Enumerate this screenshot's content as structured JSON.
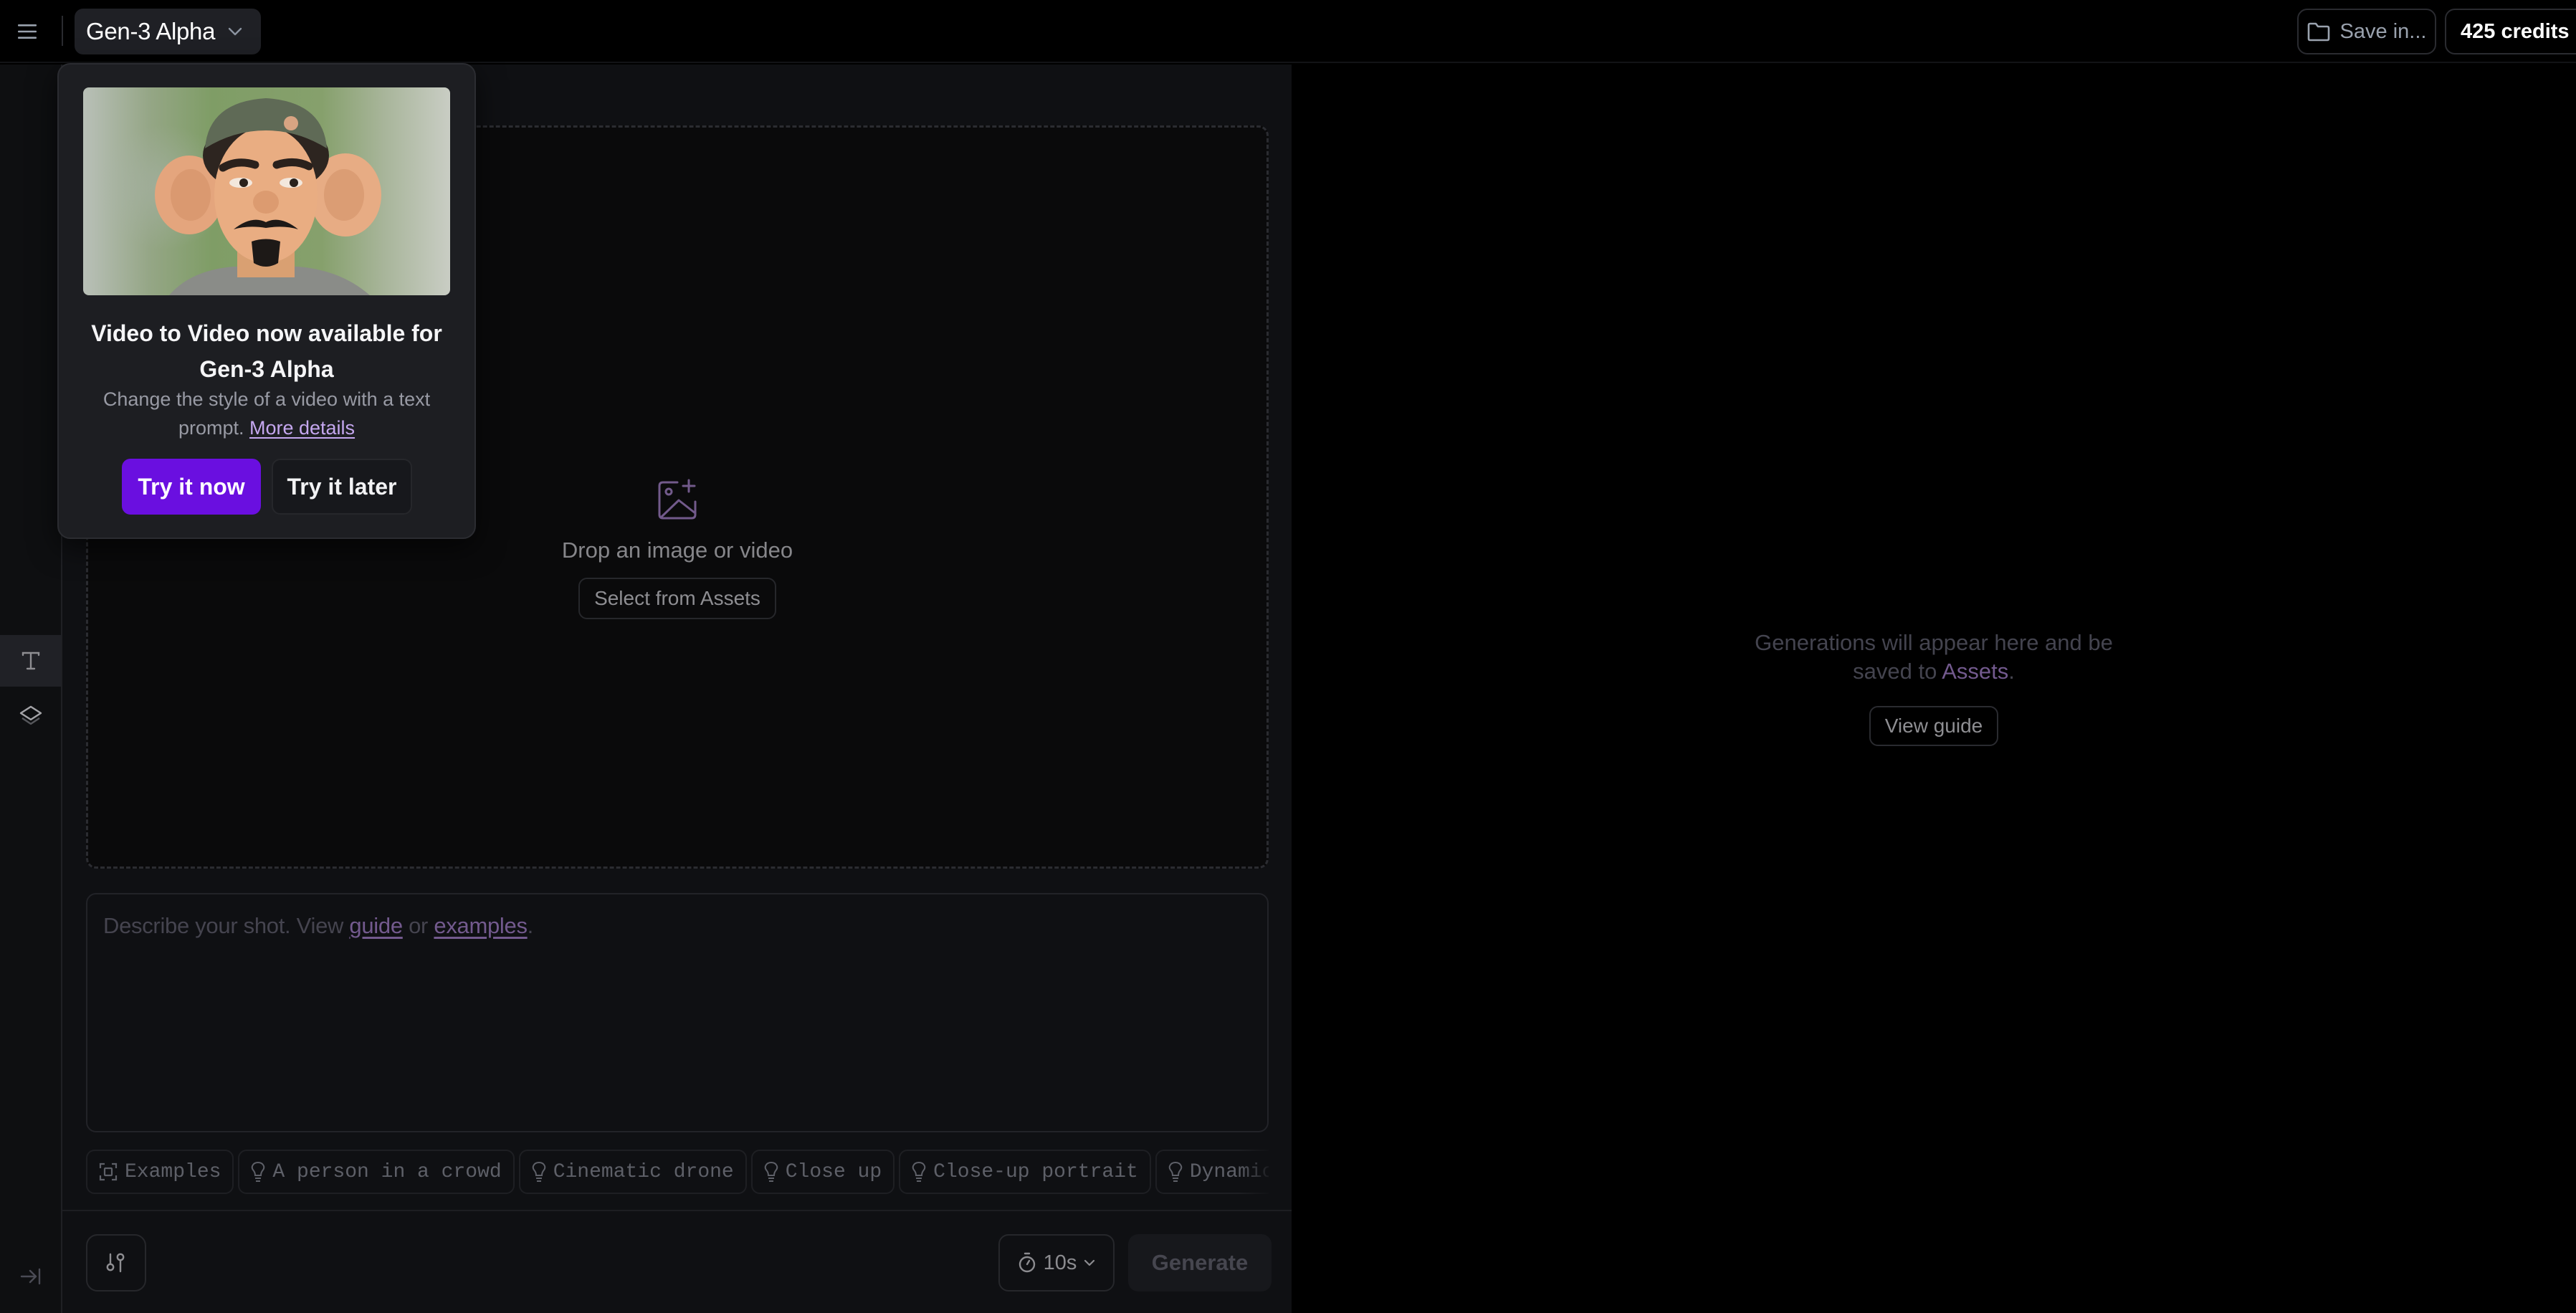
{
  "topbar": {
    "menu_icon": "hamburger-menu-icon",
    "model_name": "Gen-3 Alpha",
    "model_chevron_icon": "chevron-down-icon",
    "save_label": "Save in...",
    "save_icon": "folder-icon",
    "credits_label": "425 credits"
  },
  "rail": {
    "items": [
      {
        "name": "text-tool",
        "icon": "text-icon",
        "active": true
      },
      {
        "name": "layers-tool",
        "icon": "layers-icon",
        "active": false
      }
    ],
    "collapse_icon": "expand-sidebar-icon"
  },
  "dropzone": {
    "icon": "image-plus-icon",
    "title": "Drop an image or video",
    "select_label": "Select from Assets"
  },
  "prompt": {
    "placeholder_prefix": "Describe your shot. View ",
    "guide_link": "guide",
    "or_text": " or ",
    "examples_link": "examples",
    "suffix": "."
  },
  "chips": [
    {
      "icon": "scan-icon",
      "label": "Examples"
    },
    {
      "icon": "lightbulb-icon",
      "label": "A person in a crowd"
    },
    {
      "icon": "lightbulb-icon",
      "label": "Cinematic drone"
    },
    {
      "icon": "lightbulb-icon",
      "label": "Close up"
    },
    {
      "icon": "lightbulb-icon",
      "label": "Close-up portrait"
    },
    {
      "icon": "lightbulb-icon",
      "label": "Dynamic motion"
    }
  ],
  "bottombar": {
    "settings_icon": "sliders-icon",
    "duration_value": "10s",
    "duration_icon": "stopwatch-icon",
    "generate_label": "Generate"
  },
  "right_panel": {
    "empty_text_prefix": "Generations will appear here and be saved to ",
    "assets_link": "Assets",
    "empty_text_suffix": ".",
    "view_guide_label": "View guide"
  },
  "popup": {
    "image_alt": "Clay figurine of a man with large ears, cap and mustache",
    "title": "Video to Video now available for Gen-3 Alpha",
    "description": "Change the style of a video with a text prompt. ",
    "link_label": "More details",
    "primary_label": "Try it now",
    "secondary_label": "Try it later"
  },
  "colors": {
    "accent": "#6a0fe0",
    "link": "#c5a7ef",
    "muted_link": "#735a8e",
    "background": "#000000",
    "panel": "#0f1013"
  }
}
